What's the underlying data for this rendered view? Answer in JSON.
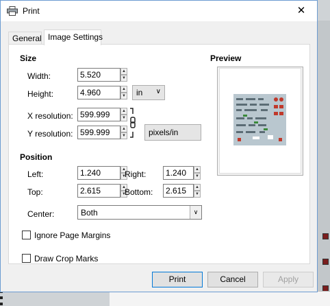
{
  "window": {
    "title": "Print"
  },
  "tabs": [
    {
      "label": "General"
    },
    {
      "label": "Image Settings"
    }
  ],
  "size": {
    "heading": "Size",
    "width_label": "Width:",
    "width_value": "5.520",
    "height_label": "Height:",
    "height_value": "4.960",
    "size_units": "in",
    "xres_label": "X resolution:",
    "xres_value": "599.999",
    "yres_label": "Y resolution:",
    "yres_value": "599.999",
    "res_units": "pixels/in"
  },
  "position": {
    "heading": "Position",
    "left_label": "Left:",
    "left_value": "1.240",
    "right_label": "Right:",
    "right_value": "1.240",
    "top_label": "Top:",
    "top_value": "2.615",
    "bottom_label": "Bottom:",
    "bottom_value": "2.615",
    "center_label": "Center:",
    "center_value": "Both"
  },
  "preview": {
    "heading": "Preview"
  },
  "options": {
    "ignore_margins": {
      "label": "Ignore Page Margins",
      "checked": false
    },
    "crop_marks": {
      "label": "Draw Crop Marks",
      "checked": false
    }
  },
  "buttons": {
    "print": "Print",
    "cancel": "Cancel",
    "apply": "Apply"
  },
  "colors": {
    "accent": "#0078d7",
    "dialog_bg": "#f0f0f0"
  }
}
